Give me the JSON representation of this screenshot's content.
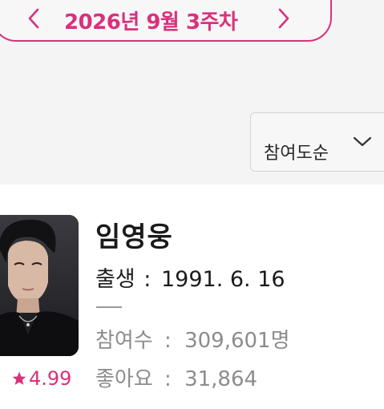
{
  "week_selector": {
    "label": "2026년 9월 3주차",
    "prev_icon": "chevron-left-icon",
    "next_icon": "chevron-right-icon",
    "accent_color": "#d8317c"
  },
  "sort": {
    "selected": "참여도순",
    "icon": "chevron-down-icon"
  },
  "card": {
    "name": "임영웅",
    "birth_label": "출생",
    "birth_sep": ":",
    "birth_date": "1991. 6. 16",
    "rating": "4.99",
    "rating_icon": "star-icon",
    "participants_label": "참여수",
    "participants_sep": ":",
    "participants_value": "309,601명",
    "likes_label": "좋아요",
    "likes_sep": ":",
    "likes_value": "31,864"
  }
}
